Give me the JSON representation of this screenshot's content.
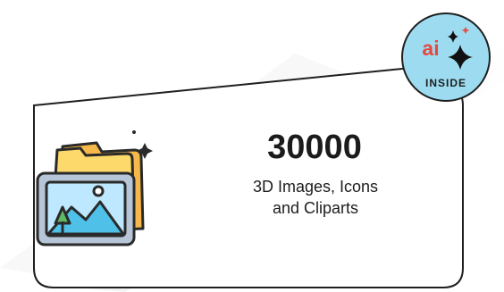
{
  "badge": {
    "ai_text": "ai",
    "inside_text": "INSIDE",
    "icon": "sparkle-icon",
    "color_bg": "#9ddcf0",
    "color_ai": "#e8473e"
  },
  "stat": {
    "count": "30000",
    "description_line1": "3D Images, Icons",
    "description_line2": "and Cliparts"
  },
  "illustration": {
    "icon": "image-folder-icon"
  }
}
